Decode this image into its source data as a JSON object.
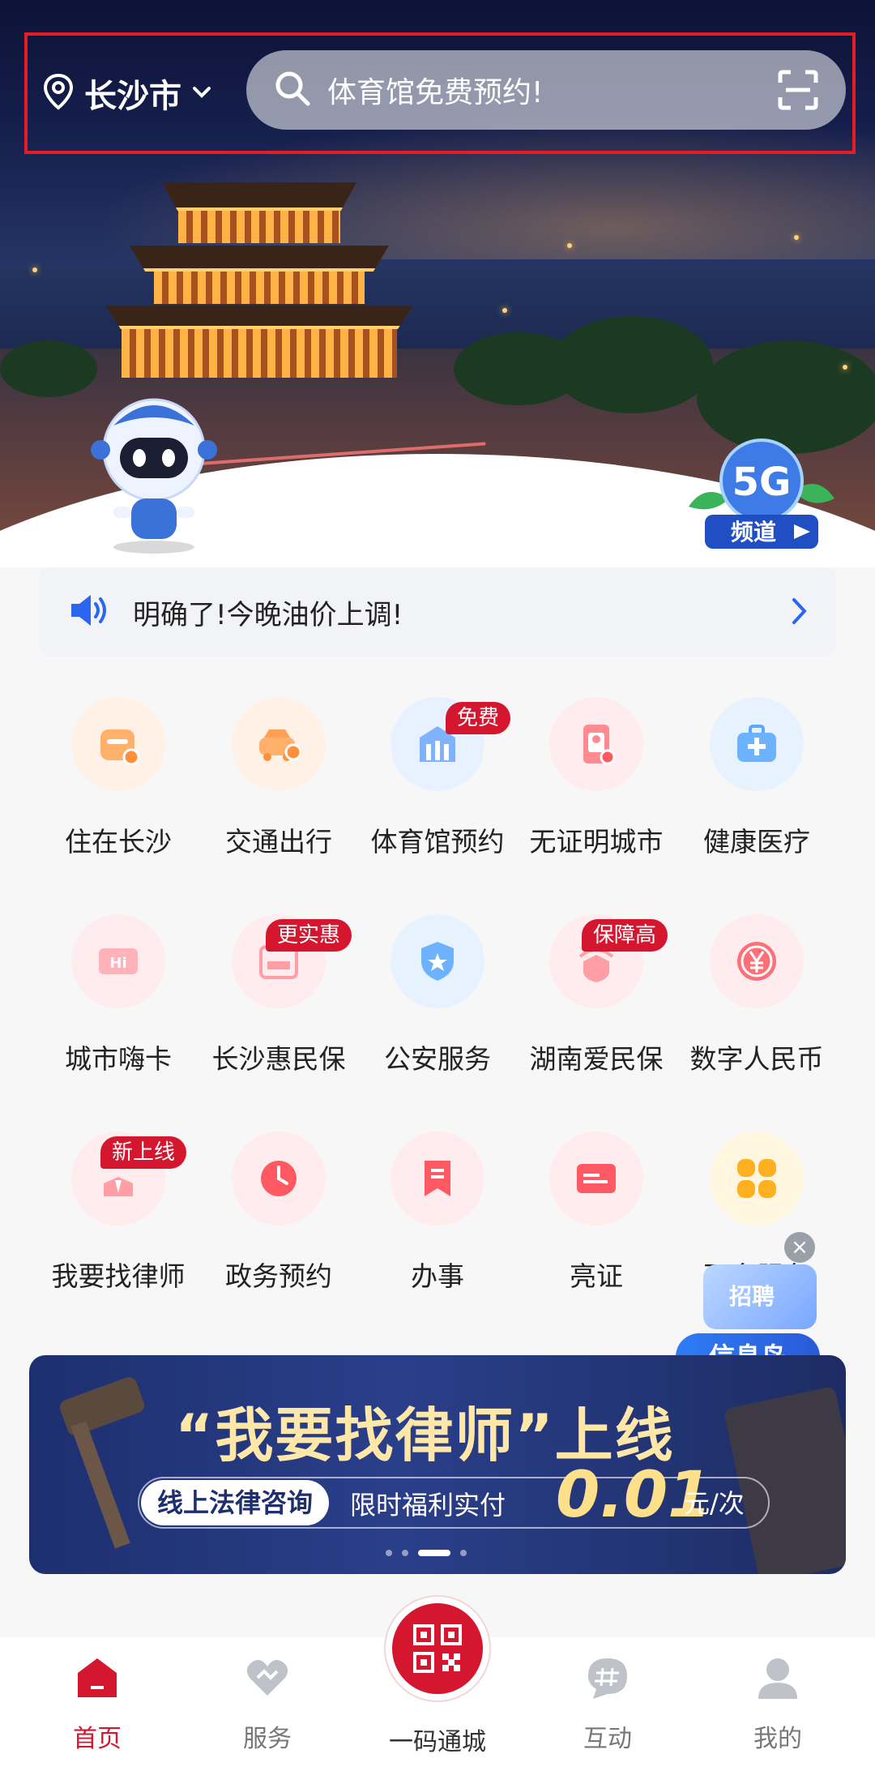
{
  "header": {
    "city": "长沙市",
    "search_placeholder": "体育馆免费预约!"
  },
  "hero": {
    "channel_badge_top": "5G",
    "channel_badge_bottom": "频道"
  },
  "notice": {
    "text": "明确了!今晚油价上调!"
  },
  "services": [
    {
      "label": "住在长沙",
      "icon": "house-location-icon",
      "badge": null
    },
    {
      "label": "交通出行",
      "icon": "car-icon",
      "badge": null
    },
    {
      "label": "体育馆预约",
      "icon": "stadium-icon",
      "badge": "免费"
    },
    {
      "label": "无证明城市",
      "icon": "id-phone-icon",
      "badge": null
    },
    {
      "label": "健康医疗",
      "icon": "medical-kit-icon",
      "badge": null
    },
    {
      "label": "城市嗨卡",
      "icon": "hi-card-icon",
      "badge": null
    },
    {
      "label": "长沙惠民保",
      "icon": "insurance-card-icon",
      "badge": "更实惠"
    },
    {
      "label": "公安服务",
      "icon": "police-badge-icon",
      "badge": null
    },
    {
      "label": "湖南爱民保",
      "icon": "shield-icon",
      "badge": "保障高"
    },
    {
      "label": "数字人民币",
      "icon": "yuan-coin-icon",
      "badge": null
    },
    {
      "label": "我要找律师",
      "icon": "lawyer-icon",
      "badge": "新上线"
    },
    {
      "label": "政务预约",
      "icon": "clock-icon",
      "badge": null
    },
    {
      "label": "办事",
      "icon": "bookmark-icon",
      "badge": null
    },
    {
      "label": "亮证",
      "icon": "card-icon",
      "badge": null
    },
    {
      "label": "更多服务",
      "icon": "grid-icon",
      "badge": null
    }
  ],
  "float_card": {
    "tag": "招聘",
    "label": "信息岛"
  },
  "banner": {
    "title": "“我要找律师”上线",
    "tag": "线上法律咨询",
    "promo": "限时福利实付",
    "price": "0.01",
    "unit": "元/次"
  },
  "nav": {
    "items": [
      {
        "label": "首页",
        "icon": "home-icon",
        "active": true
      },
      {
        "label": "服务",
        "icon": "service-icon",
        "active": false
      },
      {
        "label": "一码通城",
        "icon": "qr-code-icon",
        "active": false
      },
      {
        "label": "互动",
        "icon": "chat-hash-icon",
        "active": false
      },
      {
        "label": "我的",
        "icon": "user-icon",
        "active": false
      }
    ]
  },
  "colors": {
    "brand_red": "#d4162e",
    "accent_blue": "#2a66f0"
  }
}
